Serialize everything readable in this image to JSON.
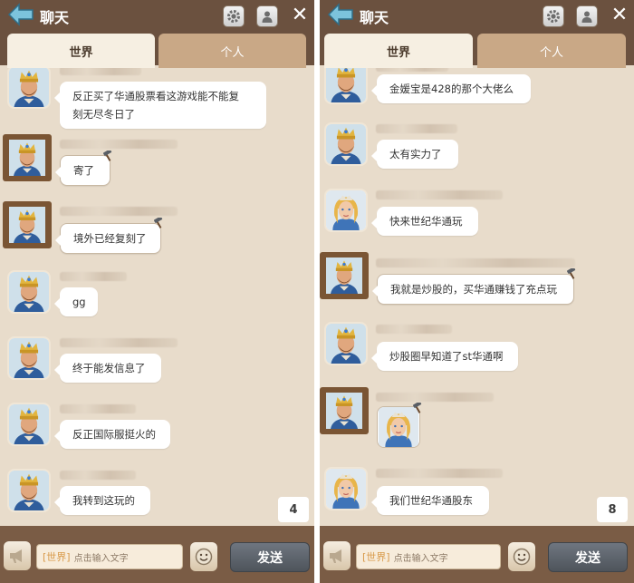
{
  "colors": {
    "topbar": "#6b513f",
    "chat_bg": "#e8dccb",
    "active_tab": "#f6efe2",
    "inactive_tab": "#c9a886",
    "send_button": "#5f666e",
    "channel_tag": "#d89a4a"
  },
  "left": {
    "header": {
      "back_icon": "back-arrow-icon",
      "title": "聊天",
      "settings_icon": "gear-icon",
      "profile_icon": "person-icon",
      "close": "✕"
    },
    "tabs": [
      {
        "label": "世界",
        "active": true
      },
      {
        "label": "个人",
        "active": false
      }
    ],
    "messages": [
      {
        "avatar": "king-avatar",
        "text1": "反正买了华通股票看这游戏能不能复",
        "text2": "刻无尽冬日了"
      },
      {
        "avatar": "framed-king-avatar",
        "text1": "寄了"
      },
      {
        "avatar": "framed-king-avatar",
        "text1": "境外已经复刻了"
      },
      {
        "avatar": "king-avatar",
        "text1": "gg"
      },
      {
        "avatar": "king-avatar",
        "text1": "终于能发信息了"
      },
      {
        "avatar": "king-avatar",
        "text1": "反正国际服挺火的"
      },
      {
        "avatar": "king-avatar",
        "text1": "我转到这玩的"
      }
    ],
    "unread_count": "4",
    "input": {
      "channel_tag": "[世界]",
      "placeholder": "点击输入文字"
    },
    "send_label": "发送"
  },
  "right": {
    "header": {
      "back_icon": "back-arrow-icon",
      "title": "聊天",
      "settings_icon": "gear-icon",
      "profile_icon": "person-icon",
      "close": "✕"
    },
    "tabs": [
      {
        "label": "世界",
        "active": true
      },
      {
        "label": "个人",
        "active": false
      }
    ],
    "messages": [
      {
        "avatar": "king-avatar",
        "text1": "金媛宝是428的那个大佬么"
      },
      {
        "avatar": "king-avatar",
        "text1": "太有实力了"
      },
      {
        "avatar": "queen-avatar",
        "text1": "快来世纪华通玩"
      },
      {
        "avatar": "framed-king-avatar",
        "text1": "我就是炒股的，买华通赚钱了充点玩"
      },
      {
        "avatar": "king-avatar",
        "text1": "炒股圈早知道了st华通啊"
      },
      {
        "avatar": "framed-king-avatar",
        "sticker": "queen-sticker"
      },
      {
        "avatar": "queen-avatar",
        "text1": "我们世纪华通股东"
      }
    ],
    "unread_count": "8",
    "input": {
      "channel_tag": "[世界]",
      "placeholder": "点击输入文字"
    },
    "send_label": "发送"
  }
}
